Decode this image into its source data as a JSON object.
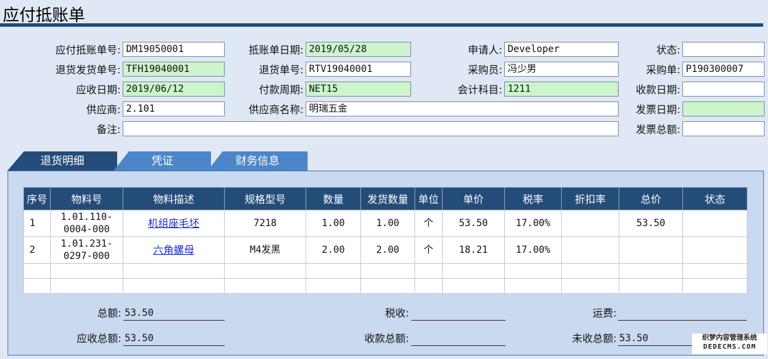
{
  "page_title": "应付抵账单",
  "header_fields": {
    "doc_no_label": "应付抵账单号:",
    "doc_no": "DM19050001",
    "doc_date_label": "抵账单日期:",
    "doc_date": "2019/05/28",
    "applicant_label": "申请人:",
    "applicant": "Developer",
    "status_label": "状态:",
    "status": "",
    "return_ship_no_label": "退货发货单号:",
    "return_ship_no": "TFH19040001",
    "return_no_label": "退货单号:",
    "return_no": "RTV19040001",
    "buyer_label": "采购员:",
    "buyer": "冯少男",
    "po_label": "采购单:",
    "po": "P190300007",
    "receivable_date_label": "应收日期:",
    "receivable_date": "2019/06/12",
    "pay_term_label": "付款周期:",
    "pay_term": "NET15",
    "account_label": "会计科目:",
    "account": "1211",
    "collect_date_label": "收款日期:",
    "collect_date": "",
    "supplier_label": "供应商:",
    "supplier": "2.101",
    "supplier_name_label": "供应商名称:",
    "supplier_name": "明瑞五金",
    "invoice_date_label": "发票日期:",
    "invoice_date": "",
    "remark_label": "备注:",
    "remark": "",
    "invoice_total_label": "发票总额:",
    "invoice_total": ""
  },
  "tabs": [
    "退货明细",
    "凭证",
    "财务信息"
  ],
  "table": {
    "headers": [
      "序号",
      "物料号",
      "物料描述",
      "规格型号",
      "数量",
      "发货数量",
      "单位",
      "单价",
      "税率",
      "折扣率",
      "总价",
      "状态"
    ],
    "rows": [
      [
        "1",
        "1.01.110-0004-000",
        "机组座毛坯",
        "7218",
        "1.00",
        "1.00",
        "个",
        "53.50",
        "17.00%",
        "",
        "53.50",
        ""
      ],
      [
        "2",
        "1.01.231-0297-000",
        "六角螺母",
        "M4发黑",
        "2.00",
        "2.00",
        "个",
        "18.21",
        "17.00%",
        "",
        "",
        ""
      ]
    ]
  },
  "summary": {
    "total_label": "总额:",
    "total": "53.50",
    "tax_label": "税收:",
    "tax": "",
    "freight_label": "运费:",
    "freight": "",
    "receivable_total_label": "应收总额:",
    "receivable_total": "53.50",
    "collected_total_label": "收款总额:",
    "collected_total": "",
    "uncollected_total_label": "未收总额:",
    "uncollected_total": "53.50"
  },
  "watermark": {
    "line1": "织梦内容管理系统",
    "line2": "DEDECMS.COM"
  },
  "colors": {
    "header_bar": "#1e4c7a",
    "tab_active": "#244c78",
    "tab_inactive": "#4b86c8",
    "required_field": "#ccf5cc",
    "link": "#1a2bd0"
  }
}
